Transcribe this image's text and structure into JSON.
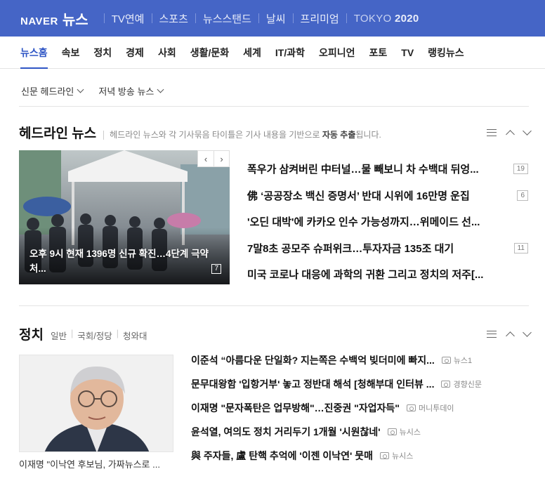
{
  "header": {
    "brand_naver": "NAVER",
    "brand_news": "뉴스",
    "nav": [
      "TV연예",
      "스포츠",
      "뉴스스탠드",
      "날씨",
      "프리미엄"
    ],
    "tokyo_prefix": "TOKYO",
    "tokyo_year": "2020",
    "bg_color": "#4565c6"
  },
  "section_nav": {
    "items": [
      "뉴스홈",
      "속보",
      "정치",
      "경제",
      "사회",
      "생활/문화",
      "세계",
      "IT/과학",
      "오피니언",
      "포토",
      "TV",
      "랭킹뉴스"
    ],
    "active_index": 0,
    "active_color": "#2f56c5"
  },
  "filters": {
    "newspaper": "신문 헤드라인",
    "evening": "저녁 방송 뉴스"
  },
  "headline": {
    "title": "헤드라인 뉴스",
    "desc_pre": "헤드라인 뉴스와 각 기사묶음 타이틀은 기사 내용을 기반으로 ",
    "desc_bold": "자동 추출",
    "desc_post": "됩니다.",
    "photo_caption": "오후 9시 현재 1396명 신규 확진…4단계 극약처...",
    "photo_count": "7",
    "items": [
      {
        "title": "폭우가 삼켜버린 中터널…물 빼보니 차 수백대 뒤엉...",
        "count": "19"
      },
      {
        "title": "佛 ‘공공장소 백신 증명서’ 반대 시위에 16만명 운집",
        "count": "6"
      },
      {
        "title": "'오딘 대박'에 카카오 인수 가능성까지…위메이드 선...",
        "count": ""
      },
      {
        "title": "7말8초 공모주 슈퍼위크…투자자금 135조 대기",
        "count": "11"
      },
      {
        "title": "미국 코로나 대응에 과학의 귀환 그리고 정치의 저주[...",
        "count": ""
      }
    ]
  },
  "politics": {
    "title": "정치",
    "subs": [
      "일반",
      "국회/정당",
      "청와대"
    ],
    "photo_caption": "이재명 \"이낙연 후보님, 가짜뉴스로 ...",
    "items": [
      {
        "title": "이준석 “아름다운 단일화? 지는쪽은 수백억 빚더미에 빠지...",
        "source": "뉴스1"
      },
      {
        "title": "문무대왕함 '입항거부' 놓고 정반대 해석 [청해부대 인터뷰 ...",
        "source": "경향신문"
      },
      {
        "title": "이재명 \"문자폭탄은 업무방해\"…진중권 \"자업자득\"",
        "source": "머니투데이"
      },
      {
        "title": "윤석열, 여의도 정치 거리두기 1개월 '시원찮네'",
        "source": "뉴시스"
      },
      {
        "title": "與 주자들, 盧 탄핵 추억에 '이젠 이낙연' 뭇매",
        "source": "뉴시스"
      }
    ]
  }
}
